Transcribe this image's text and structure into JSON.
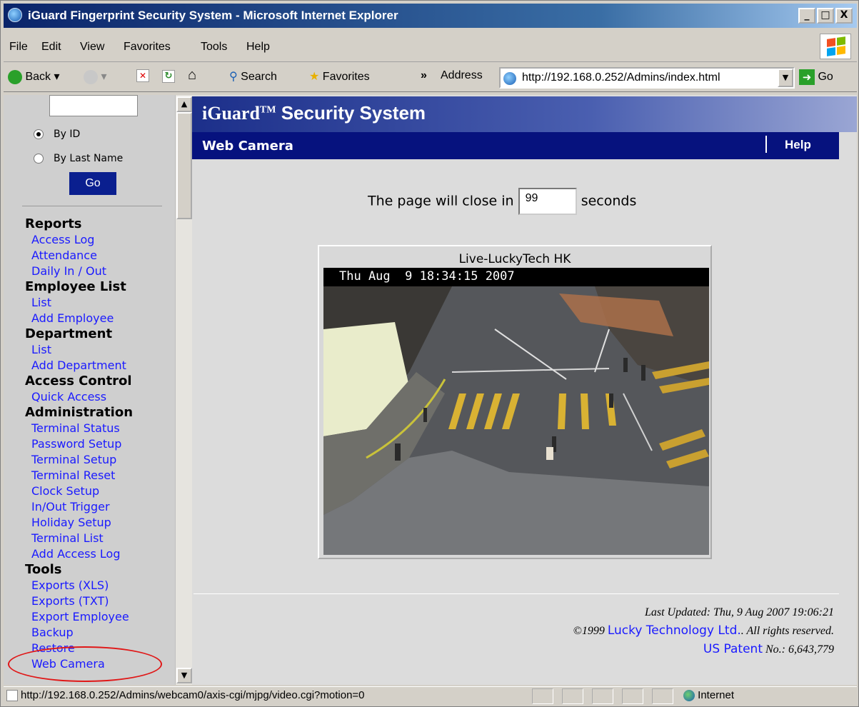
{
  "window": {
    "title": "iGuard Fingerprint Security System - Microsoft Internet Explorer",
    "minimize": "_",
    "maximize": "□",
    "close": "X"
  },
  "menu": {
    "items": [
      "File",
      "Edit",
      "View",
      "Favorites",
      "Tools",
      "Help"
    ]
  },
  "toolbar": {
    "back": "Back",
    "search": "Search",
    "favorites": "Favorites",
    "more": "»",
    "address_label": "Address",
    "address_value": "http://192.168.0.252/Admins/index.html",
    "go": "Go"
  },
  "sidebar": {
    "search_value": "",
    "radio_by_id": "By ID",
    "radio_by_last_name": "By Last Name",
    "go_button": "Go",
    "sections": [
      {
        "heading": "Reports",
        "links": [
          "Access Log",
          "Attendance",
          "Daily In / Out"
        ]
      },
      {
        "heading": "Employee List",
        "links": [
          "List",
          "Add Employee"
        ]
      },
      {
        "heading": "Department",
        "links": [
          "List",
          "Add Department"
        ]
      },
      {
        "heading": "Access Control",
        "links": [
          "Quick Access"
        ]
      },
      {
        "heading": "Administration",
        "links": [
          "Terminal Status",
          "Password Setup",
          "Terminal Setup",
          "Terminal Reset",
          "Clock Setup",
          "In/Out Trigger",
          "Holiday Setup",
          "Terminal List",
          "Add Access Log"
        ]
      },
      {
        "heading": "Tools",
        "links": [
          "Exports (XLS)",
          "Exports (TXT)",
          "Export Employee",
          "Backup",
          "Restore",
          "Web Camera"
        ]
      }
    ]
  },
  "main": {
    "banner_title": "iGuard",
    "banner_tm": "TM",
    "banner_rest": " Security System",
    "page_title": "Web Camera",
    "help": "Help",
    "close_prefix": "The page will close in",
    "countdown": "99",
    "close_suffix": "seconds",
    "camera_caption": "Live-LuckyTech HK",
    "camera_timestamp": "Thu Aug  9 18:34:15 2007",
    "last_updated": "Last Updated: Thu, 9 Aug 2007 19:06:21",
    "copyright_prefix": "©1999",
    "company_link": "Lucky Technology Ltd.",
    "copyright_suffix": ". All rights reserved.",
    "patent_link": "US Patent",
    "patent_suffix": " No.: 6,643,779"
  },
  "status": {
    "text": "http://192.168.0.252/Admins/webcam0/axis-cgi/mjpg/video.cgi?motion=0",
    "zone": "Internet"
  }
}
